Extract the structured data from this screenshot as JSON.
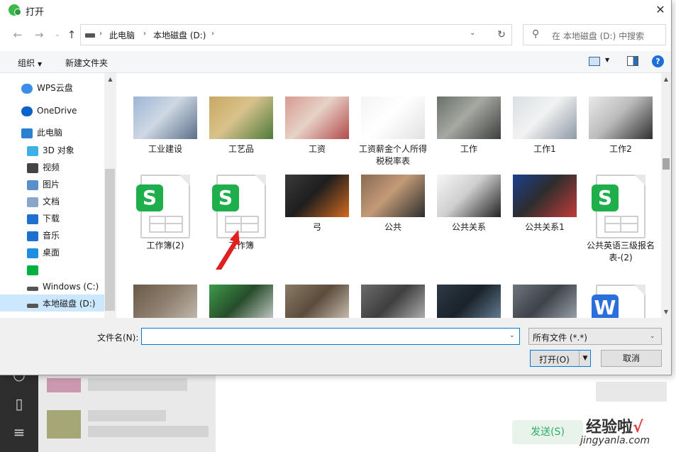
{
  "dialog": {
    "title": "打开",
    "close_glyph": "✕"
  },
  "nav": {
    "back": "←",
    "forward": "→",
    "recent": "⌄",
    "up": "↑",
    "refresh": "↻"
  },
  "address": {
    "sep": "›",
    "crumbs": [
      "此电脑",
      "本地磁盘 (D:)"
    ],
    "dropdown": "⌄"
  },
  "search": {
    "icon": "⚲",
    "placeholder": "在 本地磁盘 (D:) 中搜索"
  },
  "toolbar": {
    "organize": "组织",
    "organize_caret": "▼",
    "new_folder": "新建文件夹",
    "view_caret": "▼",
    "help": "?"
  },
  "navpane": {
    "items": [
      {
        "label": "WPS云盘",
        "icon": "cloud-icon",
        "color": "#3a8ee6"
      },
      {
        "label": "OneDrive",
        "icon": "cloud-icon",
        "color": "#0a64c8"
      },
      {
        "label": "此电脑",
        "icon": "monitor-icon",
        "color": "#2c7fd1"
      },
      {
        "label": "3D 对象",
        "icon": "cube-icon",
        "color": "#3db1e6"
      },
      {
        "label": "视频",
        "icon": "film-icon",
        "color": "#444444"
      },
      {
        "label": "图片",
        "icon": "picture-icon",
        "color": "#5b8fc7"
      },
      {
        "label": "文档",
        "icon": "document-icon",
        "color": "#8aa7c9"
      },
      {
        "label": "下载",
        "icon": "download-arrow-icon",
        "color": "#1f6fcf"
      },
      {
        "label": "音乐",
        "icon": "music-note-icon",
        "color": "#1f6fcf"
      },
      {
        "label": "桌面",
        "icon": "desktop-icon",
        "color": "#1e8fe0"
      },
      {
        "label": "",
        "icon": "iqiyi-icon",
        "color": "#00b140"
      },
      {
        "label": "Windows (C:)",
        "icon": "drive-icon",
        "color": "#555555"
      },
      {
        "label": "本地磁盘 (D:)",
        "icon": "drive-icon",
        "color": "#555555"
      }
    ],
    "scroll_up": "▲"
  },
  "files": [
    {
      "label": "工业建设",
      "kind": "image",
      "colors": [
        "#9cb6d6",
        "#5b6f8a",
        "#cfd8e3"
      ]
    },
    {
      "label": "工艺品",
      "kind": "image",
      "colors": [
        "#c9a862",
        "#4d7a3a",
        "#d8c28c"
      ]
    },
    {
      "label": "工资",
      "kind": "image",
      "colors": [
        "#d79a8f",
        "#b24a4a",
        "#e7d2c7"
      ]
    },
    {
      "label": "工资薪金个人所得税税率表",
      "kind": "image",
      "colors": [
        "#f4f4f4",
        "#e2e2e2",
        "#ffffff"
      ]
    },
    {
      "label": "工作",
      "kind": "image",
      "colors": [
        "#6b6f6a",
        "#3c3f3d",
        "#a5a9a2"
      ]
    },
    {
      "label": "工作1",
      "kind": "image",
      "colors": [
        "#d9dfe4",
        "#8e9aa6",
        "#f2f2f2"
      ]
    },
    {
      "label": "工作2",
      "kind": "image",
      "colors": [
        "#e9e9e9",
        "#2f2f2f",
        "#bcbcbc"
      ]
    },
    {
      "label": "工作簿(2)",
      "kind": "wps-sheet",
      "badge": "S",
      "color": "#1fae4c"
    },
    {
      "label": "工作簿",
      "kind": "wps-sheet",
      "badge": "S",
      "color": "#1fae4c"
    },
    {
      "label": "弓",
      "kind": "image",
      "colors": [
        "#3a3a3a",
        "#d46a1f",
        "#1e1e1e"
      ]
    },
    {
      "label": "公共",
      "kind": "image",
      "colors": [
        "#8a6a52",
        "#2d2d2d",
        "#c29a77"
      ]
    },
    {
      "label": "公共关系",
      "kind": "image",
      "colors": [
        "#f6f6f6",
        "#222222",
        "#cfcfcf"
      ]
    },
    {
      "label": "公共关系1",
      "kind": "image",
      "colors": [
        "#1b3f8f",
        "#c23b3b",
        "#2d2d2d"
      ]
    },
    {
      "label": "公共英语三级报名表-(2)",
      "kind": "wps-sheet",
      "badge": "S",
      "color": "#1fae4c"
    },
    {
      "label": "",
      "kind": "image",
      "colors": [
        "#6a5a4a",
        "#c9c1b7",
        "#8c7d6d"
      ]
    },
    {
      "label": "",
      "kind": "image",
      "colors": [
        "#3f9a4a",
        "#d8d8d8",
        "#264d2a"
      ]
    },
    {
      "label": "",
      "kind": "image",
      "colors": [
        "#8a7a66",
        "#d9cfc1",
        "#5b4c3c"
      ]
    },
    {
      "label": "",
      "kind": "image",
      "colors": [
        "#6b6b6b",
        "#bfbfbf",
        "#3f3f3f"
      ]
    },
    {
      "label": "",
      "kind": "image",
      "colors": [
        "#2e3a46",
        "#6e8aa0",
        "#1a222a"
      ]
    },
    {
      "label": "",
      "kind": "image",
      "colors": [
        "#6e767c",
        "#a9b1b6",
        "#3d4348"
      ]
    },
    {
      "label": "",
      "kind": "wps-doc",
      "badge": "W",
      "color": "#2a6fdb"
    }
  ],
  "bottom": {
    "filename_label": "文件名(N):",
    "filename_value": "",
    "filename_caret": "⌄",
    "filetype_value": "所有文件 (*.*)",
    "filetype_caret": "⌄",
    "open_label": "打开(O)",
    "open_split": "▼",
    "cancel_label": "取消"
  },
  "background_app": {
    "send_label": "发送(S)",
    "watermark": "经验啦",
    "watermark_check": "√",
    "watermark_sub": "jingyanla.com"
  },
  "colors": {
    "accent": "#0078d7",
    "selection": "#cce8ff",
    "annotation": "#e11f1f"
  }
}
